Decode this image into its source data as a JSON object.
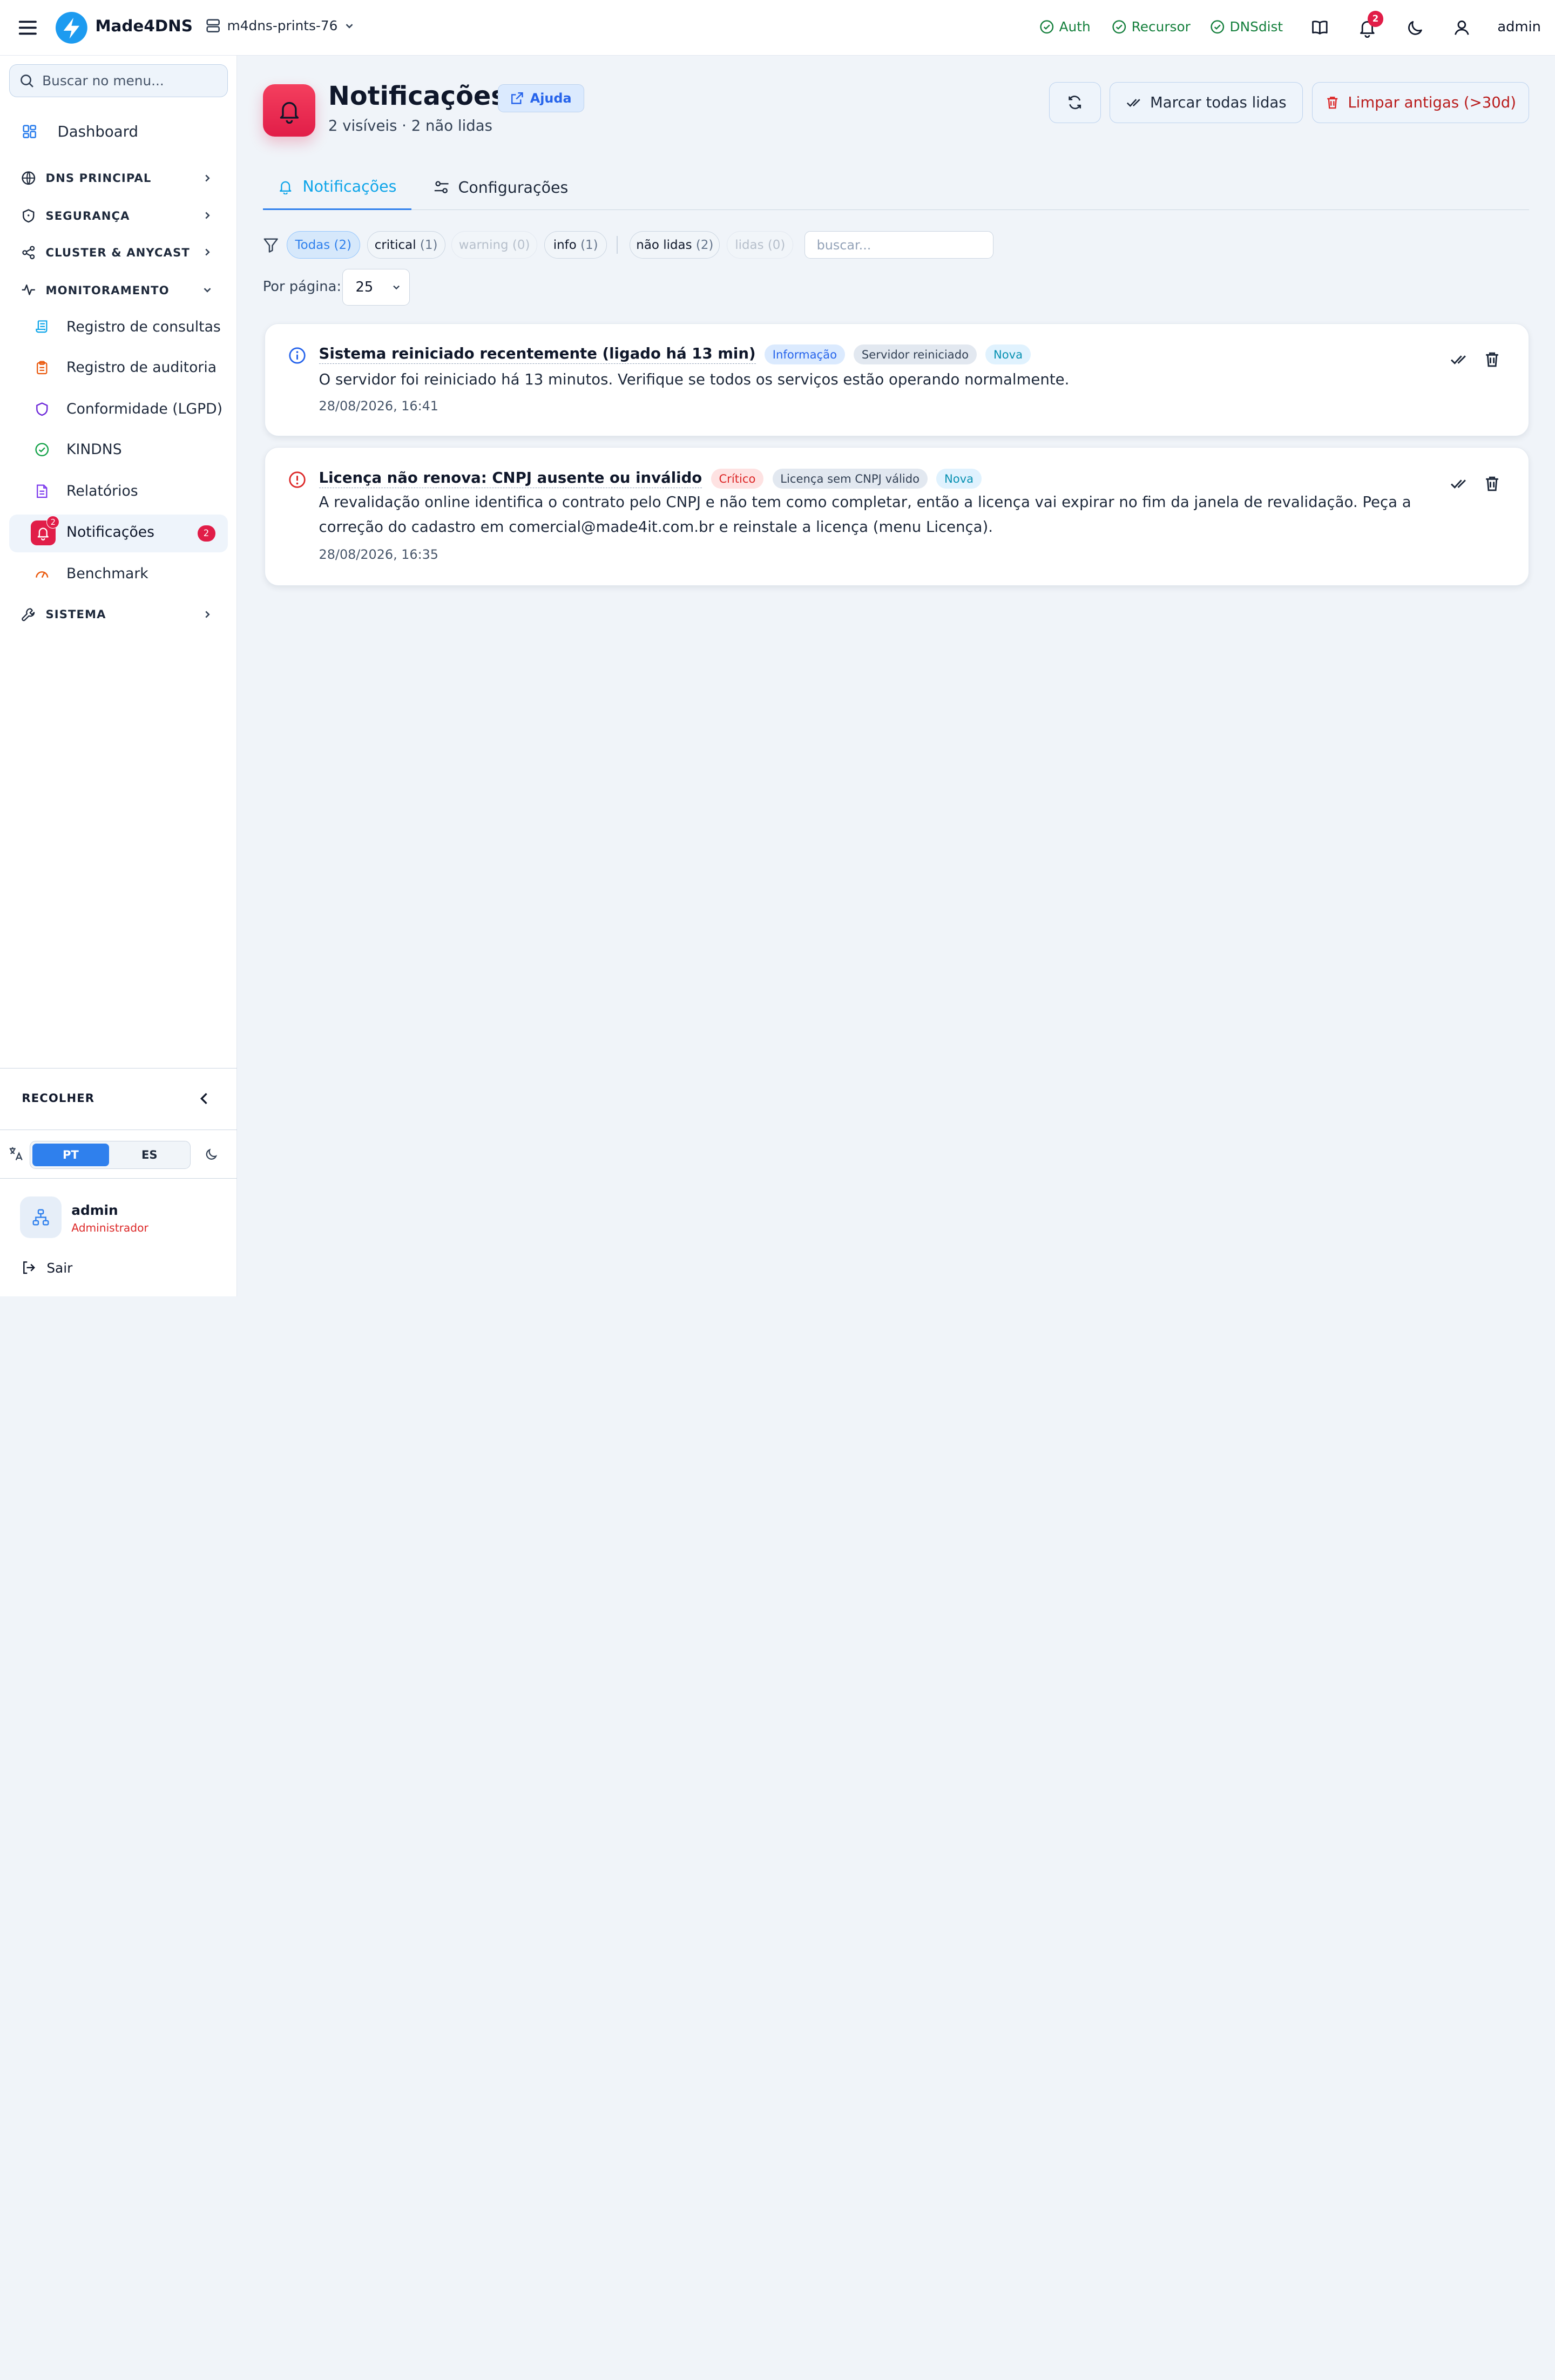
{
  "topbar": {
    "brand": "Made4DNS",
    "server": "m4dns-prints-76",
    "statuses": [
      "Auth",
      "Recursor",
      "DNSdist"
    ],
    "notif_badge": "2",
    "user": "admin"
  },
  "sidebar": {
    "search_placeholder": "Buscar no menu...",
    "dashboard": "Dashboard",
    "sections": {
      "dns": "DNS PRINCIPAL",
      "seg": "SEGURANÇA",
      "cluster": "CLUSTER & ANYCAST",
      "mon": "MONITORAMENTO",
      "sys": "SISTEMA"
    },
    "mon_items": [
      "Registro de consultas",
      "Registro de auditoria",
      "Conformidade (LGPD)",
      "KINDNS",
      "Relatórios",
      "Notificações",
      "Benchmark"
    ],
    "notif_badge": "2",
    "notif_count": "2",
    "collapse": "RECOLHER",
    "lang": {
      "pt": "PT",
      "es": "ES"
    },
    "user": {
      "name": "admin",
      "role": "Administrador"
    },
    "logout": "Sair"
  },
  "page": {
    "title": "Notificações",
    "help": "Ajuda",
    "subtitle": "2 visíveis · 2 não lidas",
    "mark_all": "Marcar todas lidas",
    "clear_old": "Limpar antigas (>30d)",
    "tabs": [
      "Notificações",
      "Configurações"
    ],
    "filters": [
      {
        "label": "Todas",
        "count": "(2)"
      },
      {
        "label": "critical",
        "count": "(1)"
      },
      {
        "label": "warning",
        "count": "(0)"
      },
      {
        "label": "info",
        "count": "(1)"
      },
      {
        "label": "não lidas",
        "count": "(2)"
      },
      {
        "label": "lidas",
        "count": "(0)"
      }
    ],
    "filter_search_placeholder": "buscar...",
    "per_page_label": "Por página:",
    "per_page_value": "25"
  },
  "notifications": [
    {
      "title": "Sistema reiniciado recentemente (ligado há 13 min)",
      "severity": "Informação",
      "category": "Servidor reiniciado",
      "state": "Nova",
      "body": "O servidor foi reiniciado há 13 minutos. Verifique se todos os serviços estão operando normalmente.",
      "date": "28/08/2026, 16:41"
    },
    {
      "title": "Licença não renova: CNPJ ausente ou inválido",
      "severity": "Crítico",
      "category": "Licença sem CNPJ válido",
      "state": "Nova",
      "body": "A revalidação online identifica o contrato pelo CNPJ e não tem como completar, então a licença vai expirar no fim da janela de revalidação. Peça a correção do cadastro em comercial@made4it.com.br e reinstale a licença (menu Licença).",
      "date": "28/08/2026, 16:35"
    }
  ],
  "colors": {
    "accent": "#2f80ed",
    "danger": "#e11d48",
    "ok": "#15803d"
  }
}
